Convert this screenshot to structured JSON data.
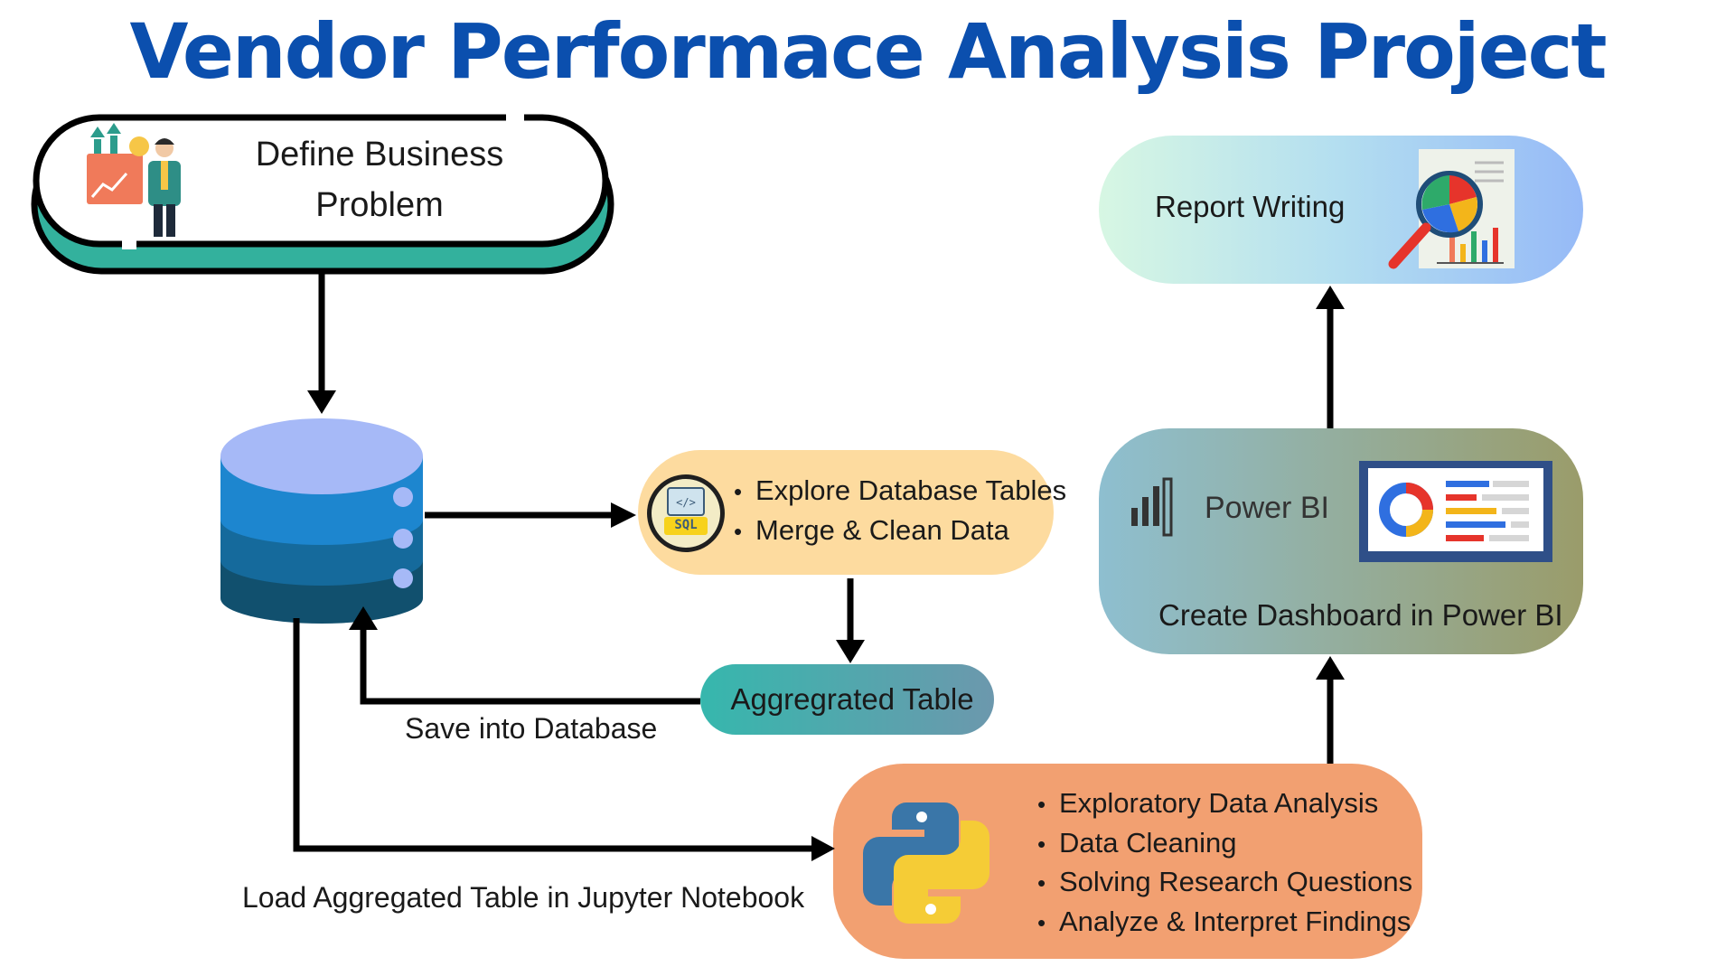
{
  "title": "Vendor Performace Analysis Project",
  "nodes": {
    "define": {
      "label": "Define Business Problem"
    },
    "sql": {
      "icon_text": "SQL",
      "items": [
        "Explore Database Tables",
        "Merge & Clean Data"
      ]
    },
    "aggregated": {
      "label": "Aggregrated Table"
    },
    "python": {
      "items": [
        "Exploratory Data Analysis",
        "Data Cleaning",
        "Solving Research Questions",
        "Analyze & Interpret Findings"
      ]
    },
    "powerbi": {
      "brand": "Power BI",
      "label": "Create Dashboard in Power BI"
    },
    "report": {
      "label": "Report Writing"
    }
  },
  "edges": {
    "save": "Save into Database",
    "load": "Load Aggregated Table in Jupyter Notebook"
  },
  "colors": {
    "title": "#0b4fae",
    "define_accent": "#33b19d",
    "sql_box": "#fddb9f",
    "aggregated_box": "#3fb3b0",
    "python_box": "#f2a071",
    "powerbi_box": "#8fb9bd",
    "report_box": "#a9c8f4"
  }
}
